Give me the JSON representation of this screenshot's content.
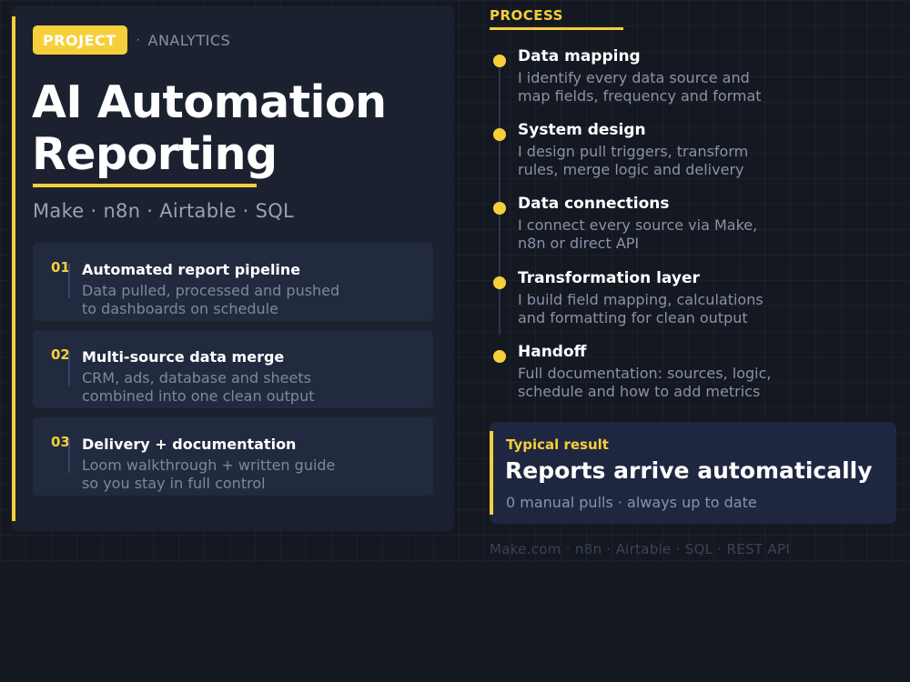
{
  "project": {
    "tag": "PROJECT",
    "separator": "·",
    "category": "ANALYTICS",
    "title_line1": "AI Automation",
    "title_line2": "Reporting",
    "stack": "Make · n8n · Airtable · SQL"
  },
  "features": [
    {
      "num": "01",
      "title": "Automated report pipeline",
      "desc_line1": "Data pulled, processed and pushed",
      "desc_line2": "to dashboards on schedule"
    },
    {
      "num": "02",
      "title": "Multi-source data merge",
      "desc_line1": "CRM, ads, database and sheets",
      "desc_line2": "combined into one clean output"
    },
    {
      "num": "03",
      "title": "Delivery + documentation",
      "desc_line1": "Loom walkthrough + written guide",
      "desc_line2": "so you stay in full control"
    }
  ],
  "process": {
    "label": "PROCESS",
    "steps": [
      {
        "title": "Data mapping",
        "desc_line1": "I identify every data source and",
        "desc_line2": "map fields, frequency and format"
      },
      {
        "title": "System design",
        "desc_line1": "I design pull triggers, transform",
        "desc_line2": "rules, merge logic and delivery"
      },
      {
        "title": "Data connections",
        "desc_line1": "I connect every source via Make,",
        "desc_line2": "n8n or direct API"
      },
      {
        "title": "Transformation layer",
        "desc_line1": "I build field mapping, calculations",
        "desc_line2": "and formatting for clean output"
      },
      {
        "title": "Handoff",
        "desc_line1": "Full documentation: sources, logic,",
        "desc_line2": "schedule and how to add metrics"
      }
    ]
  },
  "result": {
    "label": "Typical result",
    "title": "Reports arrive automatically",
    "sub": "0 manual pulls · always up to date"
  },
  "footer": "Make.com · n8n · Airtable · SQL · REST API",
  "colors": {
    "accent": "#f6cf3b",
    "panel": "#1c2130",
    "card": "#222a40",
    "background": "#141821"
  }
}
